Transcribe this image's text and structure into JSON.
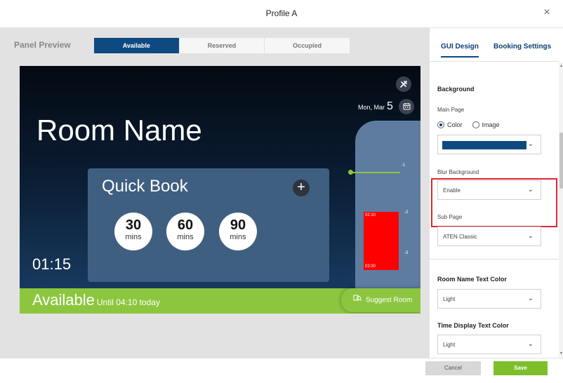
{
  "window": {
    "title": "Profile A",
    "close_glyph": "×"
  },
  "preview": {
    "label": "Panel Preview",
    "states": [
      "Available",
      "Reserved",
      "Occupied"
    ],
    "active_state": "Available"
  },
  "panel": {
    "room_name": "Room Name",
    "time": "01:15",
    "date_prefix": "Mon, Mar",
    "date_day": "5",
    "quick_book": {
      "title": "Quick Book",
      "add_glyph": "+",
      "options": [
        {
          "value": "30",
          "unit": "mins"
        },
        {
          "value": "60",
          "unit": "mins"
        },
        {
          "value": "90",
          "unit": "mins"
        }
      ]
    },
    "timeline": {
      "ticks": [
        "-1",
        "-2",
        "-3"
      ],
      "booking_start": "02:10",
      "booking_end": "03:30",
      "booking_color": "#ff0000",
      "now_line_color": "#8cc63f"
    },
    "status": {
      "text": "Available",
      "sub": "Until 04:10 today",
      "color": "#8cc63f"
    },
    "suggest_button": "Suggest Room",
    "icons": {
      "tools": "tools-icon",
      "calendar": "calendar-icon",
      "suggest": "suggest-room-icon"
    }
  },
  "settings": {
    "tabs": [
      "GUI Design",
      "Booking Settings"
    ],
    "active_tab": "GUI Design",
    "background": {
      "section_title": "Background",
      "main_page_label": "Main Page",
      "radio_options": [
        "Color",
        "Image"
      ],
      "radio_selected": "Color",
      "color_value": "#0e4a80",
      "blur_label": "Blur Background",
      "blur_value": "Enable",
      "sub_page_label": "Sub Page",
      "sub_page_value": "ATEN Classic"
    },
    "room_name_text_color": {
      "title": "Room Name Text Color",
      "value": "Light"
    },
    "time_display_text_color": {
      "title": "Time Display Text Color",
      "value": "Light"
    }
  },
  "footer": {
    "cancel": "Cancel",
    "save": "Save"
  },
  "colors": {
    "accent": "#0e4a80",
    "available_green": "#8cc63f",
    "save_green": "#7cbf2a",
    "highlight_red": "#e0282e"
  }
}
